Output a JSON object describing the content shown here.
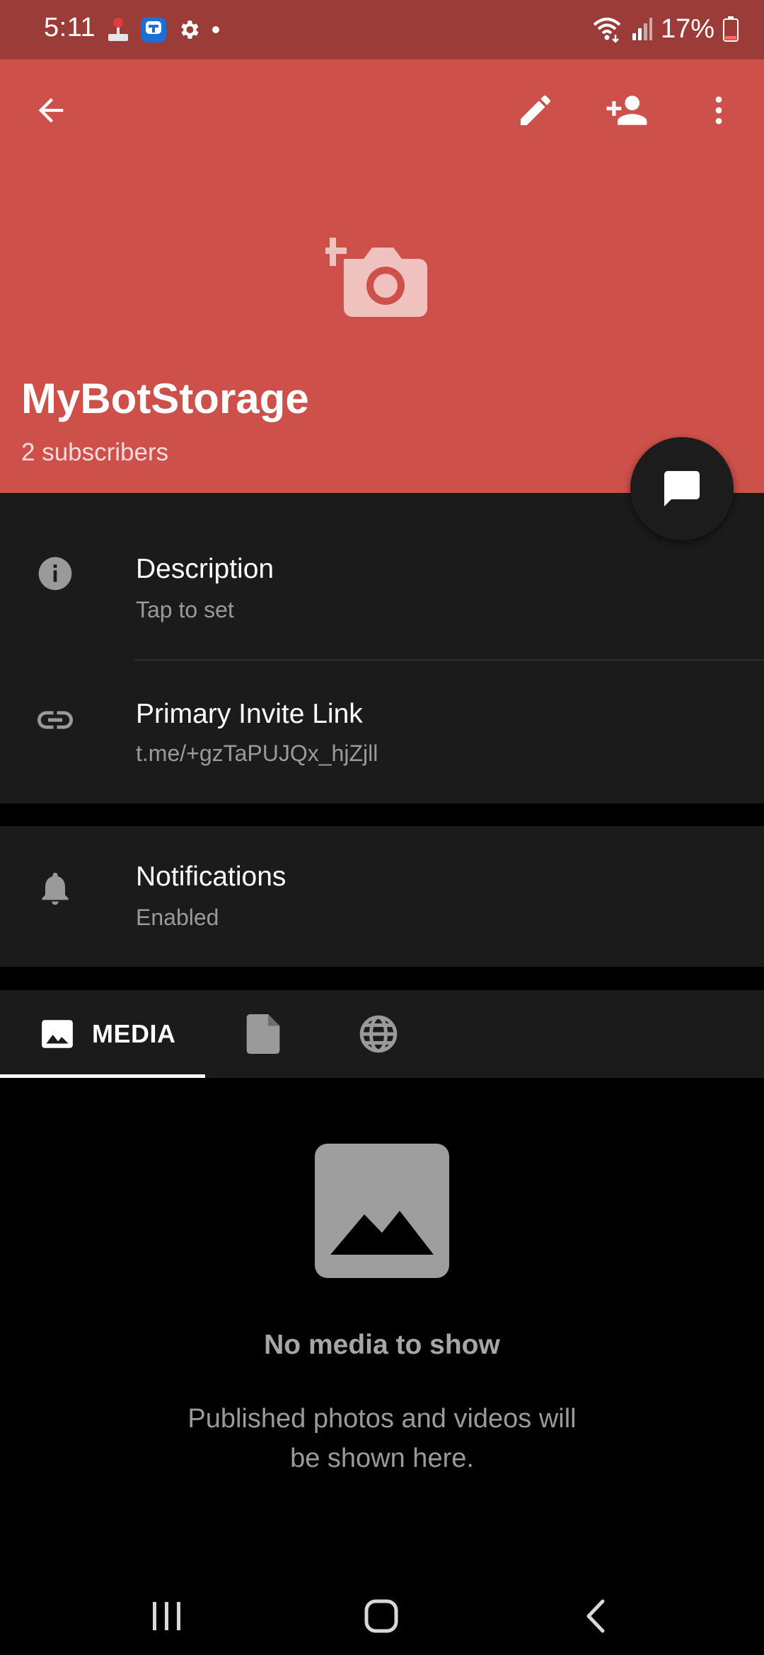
{
  "status_bar": {
    "time": "5:11",
    "battery": "17%",
    "icons_left": [
      "joystick-icon",
      "app-notification-icon",
      "gear-icon",
      "dot-icon"
    ],
    "icons_right": [
      "wifi-icon",
      "signal-icon",
      "battery-icon"
    ]
  },
  "toolbar": {
    "back_icon": "arrow-left-icon",
    "edit_icon": "pencil-icon",
    "add_member_icon": "person-add-icon",
    "more_icon": "more-vertical-icon"
  },
  "header": {
    "title": "MyBotStorage",
    "subtitle": "2 subscribers",
    "avatar_icon": "camera-add-icon",
    "header_color": "#cd504a"
  },
  "info": {
    "description": {
      "title": "Description",
      "subtitle": "Tap to set",
      "icon": "info-icon"
    },
    "invite_link": {
      "title": "Primary Invite Link",
      "subtitle": "t.me/+gzTaPUJQx_hjZjll",
      "icon": "link-icon"
    },
    "notifications": {
      "title": "Notifications",
      "subtitle": "Enabled",
      "icon": "bell-icon"
    }
  },
  "tabs": [
    {
      "label": "MEDIA",
      "icon": "image-icon",
      "selected": true
    },
    {
      "label": "",
      "icon": "file-icon",
      "selected": false
    },
    {
      "label": "",
      "icon": "globe-icon",
      "selected": false
    }
  ],
  "empty_state": {
    "title": "No media to show",
    "text": "Published photos and videos will be shown here.",
    "icon": "image-placeholder-icon"
  },
  "nav_bar": {
    "icons": [
      "recents-icon",
      "home-icon",
      "back-icon"
    ]
  }
}
